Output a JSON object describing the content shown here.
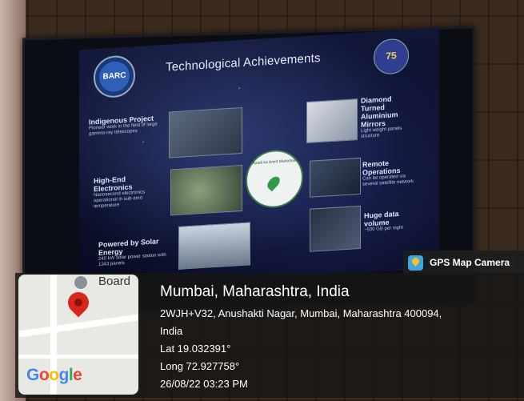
{
  "slide": {
    "title": "Technological Achievements",
    "logo_text": "BARC",
    "emblem_text": "75",
    "items_left": [
      {
        "heading": "Indigenous Project",
        "sub": "Pioneer work in the field of large gamma-ray telescopes"
      },
      {
        "heading": "High-End Electronics",
        "sub": "Nanosecond electronics operational in sub-zero temperature"
      },
      {
        "heading": "Powered by Solar Energy",
        "sub": "240 kW solar power station with 1343 panels"
      }
    ],
    "items_right": [
      {
        "heading": "Diamond Turned Aluminium Mirrors",
        "sub": "Light weight panels structure"
      },
      {
        "heading": "Remote Operations",
        "sub": "Can be operated via several satellite network"
      },
      {
        "heading": "Huge data volume",
        "sub": "~500 GB per night"
      }
    ],
    "center_text": "Azadi ka Amrit Mahotsav"
  },
  "gps": {
    "app_name": "GPS Map Camera",
    "map_label": "Board",
    "map_brand": [
      "G",
      "o",
      "o",
      "g",
      "l",
      "e"
    ],
    "location_title": "Mumbai, Maharashtra, India",
    "address_line1": "2WJH+V32, Anushakti Nagar, Mumbai, Maharashtra 400094,",
    "address_line2": "India",
    "lat": "Lat 19.032391°",
    "long": "Long 72.927758°",
    "datetime": "26/08/22 03:23 PM"
  }
}
